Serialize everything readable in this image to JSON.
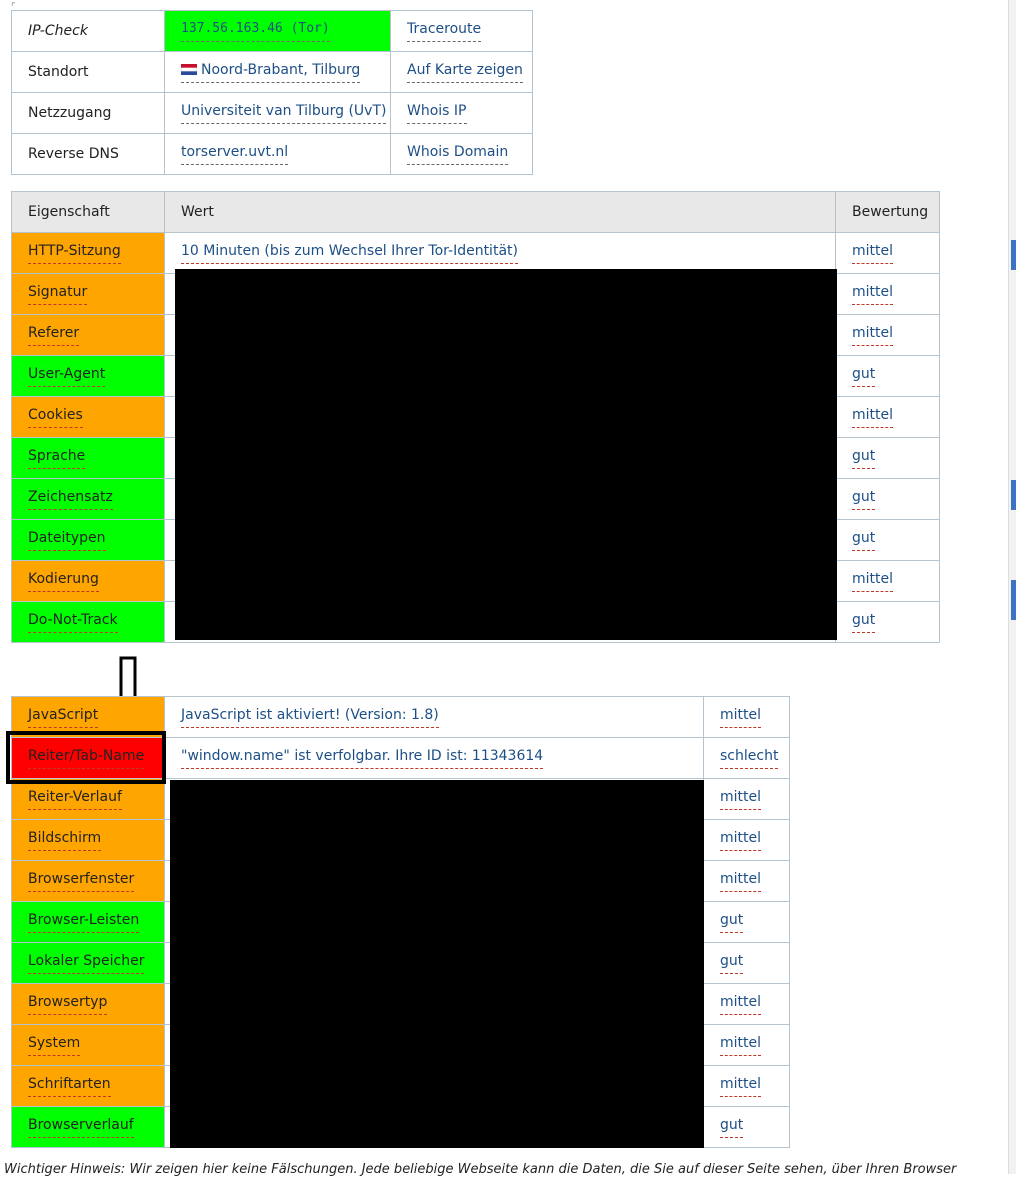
{
  "ip_check": {
    "rows": [
      {
        "label": "IP-Check",
        "value": "137.56.163.46 (Tor)",
        "action": "Traceroute"
      },
      {
        "label": "Standort",
        "value": "Noord-Brabant, Tilburg",
        "action": "Auf Karte zeigen"
      },
      {
        "label": "Netzzugang",
        "value": "Universiteit van Tilburg (UvT)",
        "action": "Whois IP"
      },
      {
        "label": "Reverse DNS",
        "value": "torserver.uvt.nl",
        "action": "Whois Domain"
      }
    ]
  },
  "table1": {
    "headers": {
      "property": "Eigenschaft",
      "value": "Wert",
      "rating": "Bewertung"
    },
    "rows": [
      {
        "property": "HTTP-Sitzung",
        "value": "10 Minuten (bis zum Wechsel Ihrer Tor-Identität)",
        "rating": "mittel"
      },
      {
        "property": "Signatur",
        "value": "",
        "rating": "mittel"
      },
      {
        "property": "Referer",
        "value": "",
        "rating": "mittel"
      },
      {
        "property": "User-Agent",
        "value": "",
        "rating": "gut"
      },
      {
        "property": "Cookies",
        "value": "",
        "rating": "mittel"
      },
      {
        "property": "Sprache",
        "value": "",
        "rating": "gut"
      },
      {
        "property": "Zeichensatz",
        "value": "",
        "rating": "gut"
      },
      {
        "property": "Dateitypen",
        "value": "",
        "rating": "gut"
      },
      {
        "property": "Kodierung",
        "value": "",
        "rating": "mittel"
      },
      {
        "property": "Do-Not-Track",
        "value": "",
        "rating": "gut"
      }
    ]
  },
  "table2": {
    "rows": [
      {
        "property": "JavaScript",
        "value": "JavaScript ist aktiviert! (Version: 1.8)",
        "rating": "mittel"
      },
      {
        "property": "Reiter/Tab-Name",
        "value": "\"window.name\" ist verfolgbar. Ihre ID ist: 11343614",
        "rating": "schlecht"
      },
      {
        "property": "Reiter-Verlauf",
        "value": "",
        "rating": "mittel"
      },
      {
        "property": "Bildschirm",
        "value": "",
        "rating": "mittel"
      },
      {
        "property": "Browserfenster",
        "value": "",
        "rating": "mittel"
      },
      {
        "property": "Browser-Leisten",
        "value": "",
        "rating": "gut"
      },
      {
        "property": "Lokaler Speicher",
        "value": "",
        "rating": "gut"
      },
      {
        "property": "Browsertyp",
        "value": "",
        "rating": "mittel"
      },
      {
        "property": "System",
        "value": "",
        "rating": "mittel"
      },
      {
        "property": "Schriftarten",
        "value": "",
        "rating": "mittel"
      },
      {
        "property": "Browserverlauf",
        "value": "",
        "rating": "gut"
      }
    ]
  },
  "footnote": "Wichtiger Hinweis: Wir zeigen hier keine Fälschungen. Jede beliebige Webseite kann die Daten, die Sie auf dieser Seite sehen, über Ihren Browser",
  "colors": {
    "gut": "#00ff00",
    "mittel": "#ffa500",
    "schlecht": "#ff0000",
    "ip_ok": "#00ff00",
    "link": "#1d4f86"
  },
  "icons": {
    "flag": "netherlands-flag-icon",
    "arrow": "down-arrow-icon"
  }
}
